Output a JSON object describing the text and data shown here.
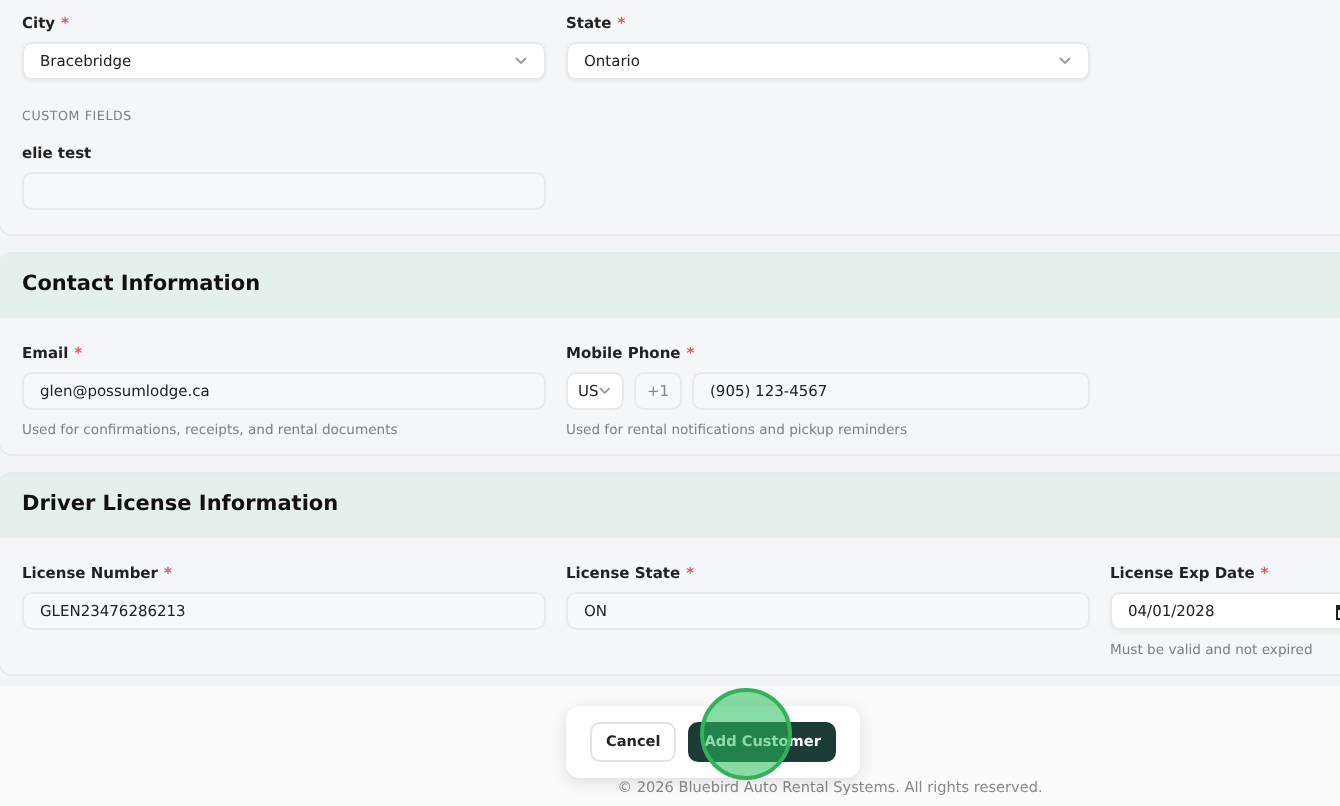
{
  "address_section": {
    "fields": [
      {
        "label": "City",
        "required_mark": "*",
        "kind": "select",
        "value": "Bracebridge"
      },
      {
        "label": "State",
        "required_mark": "*",
        "kind": "select",
        "value": "Ontario"
      }
    ],
    "custom_fields": {
      "heading": "CUSTOM FIELDS",
      "fields": [
        {
          "label": "elie test",
          "kind": "text"
        }
      ]
    }
  },
  "sections": [
    {
      "title": "Contact Information",
      "fields": [
        {
          "label": "Email",
          "required_mark": "*",
          "kind": "text",
          "value": "glen@possumlodge.ca",
          "help": "Used for confirmations, receipts, and rental documents"
        },
        {
          "label": "Mobile Phone",
          "required_mark": "*",
          "kind": "phone",
          "country": "US",
          "dial_code": "+1",
          "value": "(905) 123-4567",
          "help": "Used for rental notifications and pickup reminders"
        }
      ]
    },
    {
      "title": "Driver License Information",
      "fields": [
        {
          "label": "License Number",
          "required_mark": "*",
          "kind": "text",
          "value": "GLEN23476286213"
        },
        {
          "label": "License State",
          "required_mark": "*",
          "kind": "text",
          "value": "ON"
        },
        {
          "label": "License Exp Date",
          "required_mark": "*",
          "kind": "date",
          "value": "04/01/2028",
          "help": "Must be valid and not expired"
        }
      ]
    }
  ],
  "actions": [
    {
      "label": "Cancel",
      "kind": "secondary"
    },
    {
      "label": "Add Customer",
      "kind": "primary"
    }
  ],
  "footer": "© 2026 Bluebird Auto Rental Systems. All rights reserved."
}
